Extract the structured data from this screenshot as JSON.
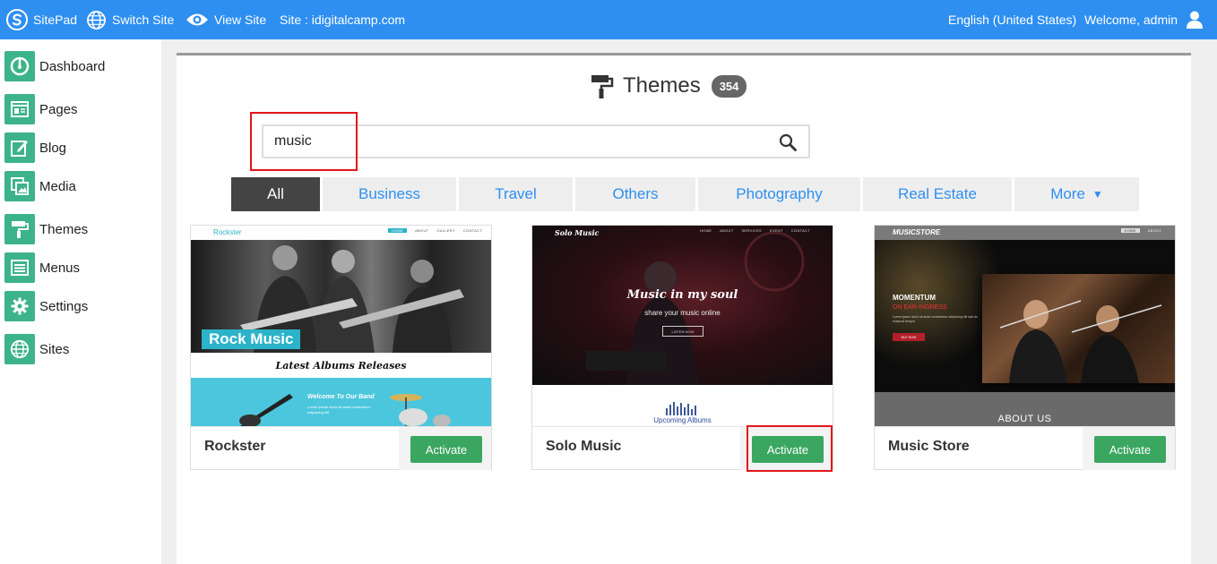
{
  "topbar": {
    "brand": "SitePad",
    "switch_site": "Switch Site",
    "view_site": "View Site",
    "site": "Site : idigitalcamp.com",
    "language": "English (United States)",
    "welcome": "Welcome, admin"
  },
  "sidebar": {
    "items": [
      {
        "label": "Dashboard",
        "icon": "dashboard-icon"
      },
      {
        "label": "Pages",
        "icon": "pages-icon"
      },
      {
        "label": "Blog",
        "icon": "blog-icon"
      },
      {
        "label": "Media",
        "icon": "media-icon"
      },
      {
        "label": "Themes",
        "icon": "paint-roller-icon"
      },
      {
        "label": "Menus",
        "icon": "menus-icon"
      },
      {
        "label": "Settings",
        "icon": "gear-icon"
      },
      {
        "label": "Sites",
        "icon": "globe-icon"
      }
    ]
  },
  "main": {
    "title": "Themes",
    "count": "354",
    "search": {
      "value": "music",
      "placeholder": ""
    },
    "tabs": [
      {
        "label": "All",
        "active": true
      },
      {
        "label": "Business"
      },
      {
        "label": "Travel"
      },
      {
        "label": "Others"
      },
      {
        "label": "Photography"
      },
      {
        "label": "Real Estate"
      },
      {
        "label": "More"
      }
    ],
    "themes": [
      {
        "name": "Rockster",
        "action": "Activate",
        "preview": {
          "logo": "Rockster",
          "nav": [
            "HOME",
            "ABOUT",
            "GALLERY",
            "CONTACT"
          ],
          "hero_label": "Rock Music",
          "section_title": "Latest Albums Releases",
          "band_title": "Welcome To Our Band",
          "band_text": "Lorem ipsum dolor sit amet consectetur adipiscing elit"
        }
      },
      {
        "name": "Solo Music",
        "action": "Activate",
        "preview": {
          "logo": "Solo Music",
          "nav": [
            "HOME",
            "ABOUT",
            "SERVICES",
            "EVENT",
            "CONTACT"
          ],
          "hero_title": "Music in my soul",
          "hero_sub": "share your music online",
          "hero_button": "LISTEN NOW",
          "section_title": "Upcoming Albums"
        }
      },
      {
        "name": "Music Store",
        "action": "Activate",
        "preview": {
          "logo": "MUSICSTORE",
          "nav": [
            "HOME",
            "ABOUT"
          ],
          "hero_title": "MOMENTUM",
          "hero_sub": "ON EAR-INGRESS",
          "hero_text": "Lorem ipsum dolor sit amet consectetur adipiscing elit sed do eiusmod tempor",
          "hero_button": "BUY NOW",
          "section_title": "ABOUT US"
        }
      }
    ]
  },
  "colors": {
    "topbar": "#2e8ff0",
    "sidebar_icon": "#3db38a",
    "activate": "#3aa660",
    "highlight": "#e3141b",
    "tab_active": "#444444",
    "tab_text": "#2e8ff0"
  }
}
